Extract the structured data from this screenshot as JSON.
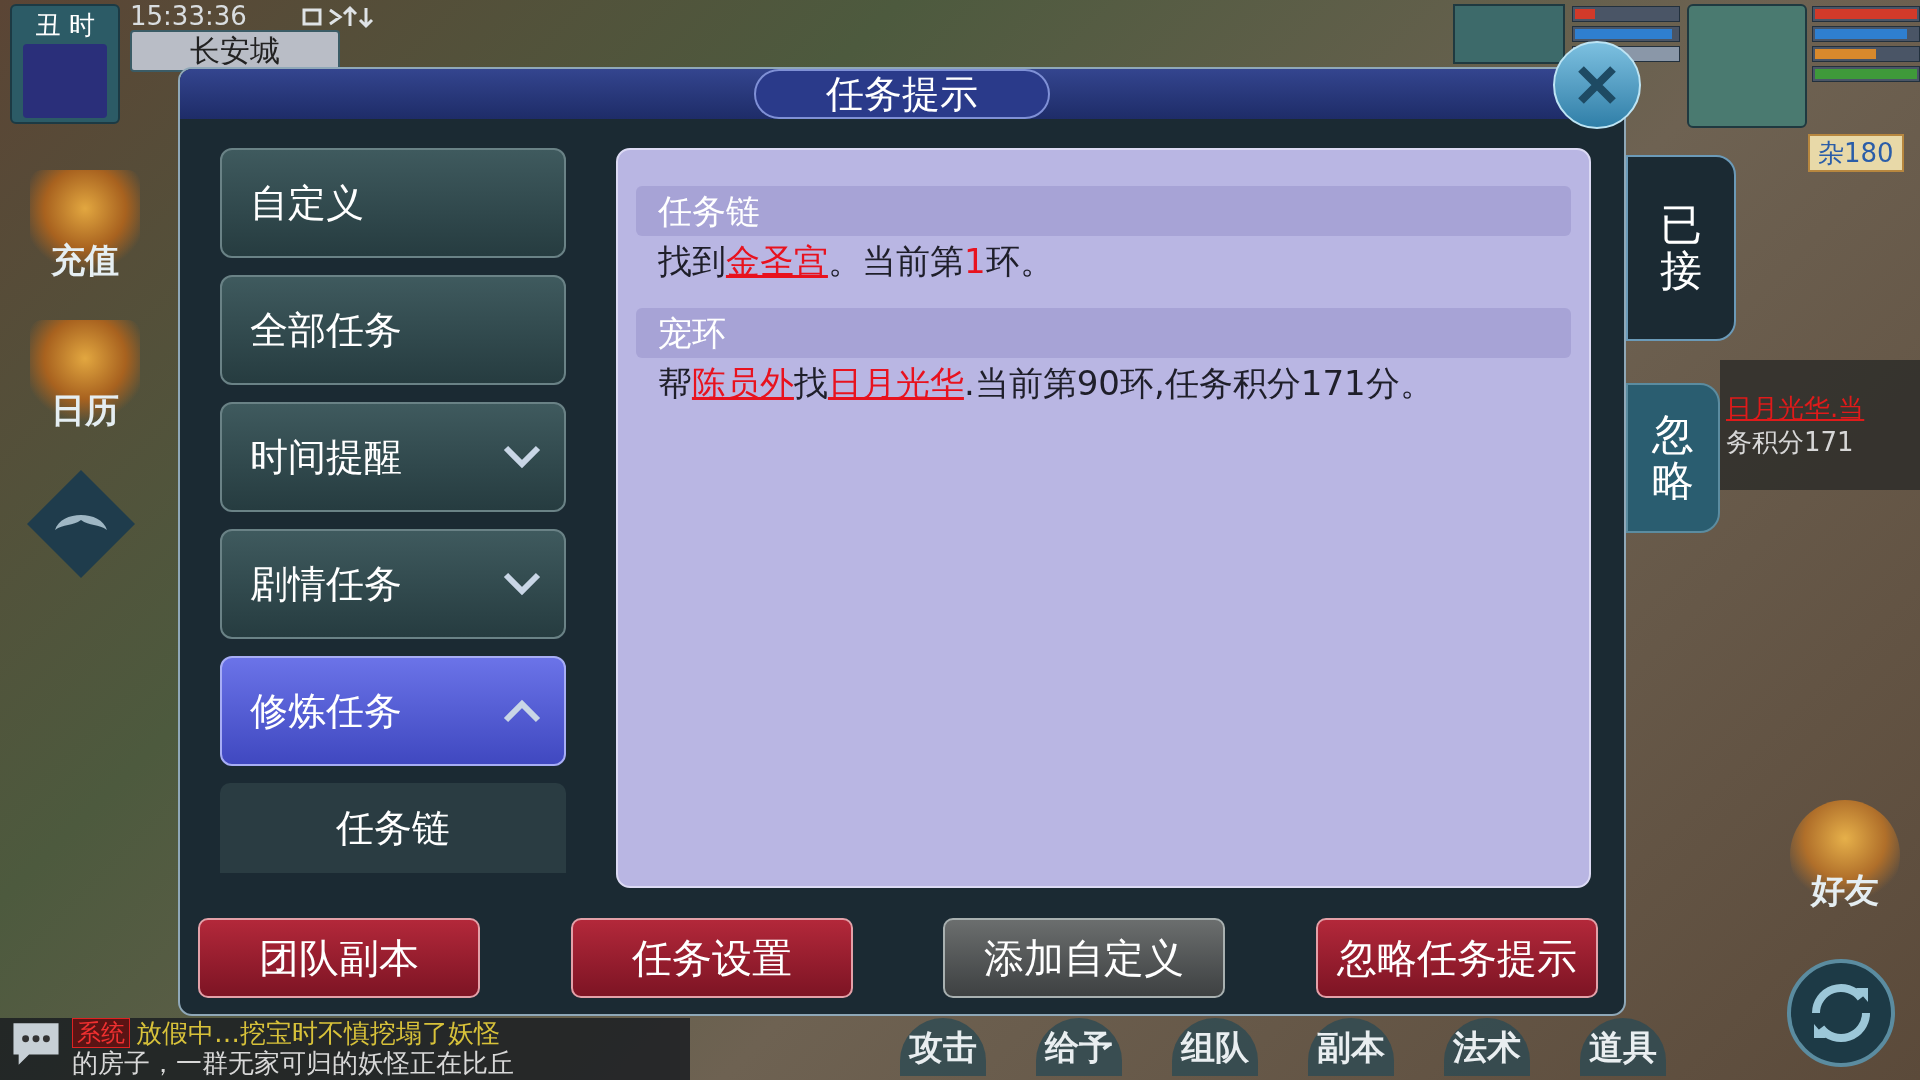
{
  "hud": {
    "time_period": "丑 时",
    "clock": "15:33:36",
    "location": "长安城",
    "side_buttons": [
      "充值",
      "日历"
    ],
    "tag": "杂180",
    "tracker": [
      "日月光华.当",
      "务积分171"
    ],
    "pet_bars": [
      {
        "color": "#d23a2a",
        "level": 0.2
      },
      {
        "color": "#2f7fd0",
        "level": 0.95
      }
    ],
    "player_bars": [
      {
        "color": "#d23a2a",
        "level": 1
      },
      {
        "color": "#2f7fd0",
        "level": 0.9
      },
      {
        "color": "#d8892c",
        "level": 0.6
      },
      {
        "color": "#3f9a3a",
        "level": 1
      }
    ],
    "chat": {
      "channel": "系统",
      "lines": [
        "放假中…挖宝时不慎挖塌了妖怪",
        "的房子，一群无家可归的妖怪正在比丘"
      ]
    },
    "actions": [
      "攻击",
      "给予",
      "组队",
      "副本",
      "法术",
      "道具"
    ],
    "friends": "好友"
  },
  "dialog": {
    "title": "任务提示",
    "menu": [
      {
        "label": "自定义",
        "selected": false
      },
      {
        "label": "全部任务",
        "selected": false
      },
      {
        "label": "时间提醒",
        "selected": false,
        "expanded": false
      },
      {
        "label": "剧情任务",
        "selected": false,
        "expanded": false
      },
      {
        "label": "修炼任务",
        "selected": true,
        "expanded": true,
        "children": [
          {
            "label": "任务链"
          }
        ]
      }
    ],
    "sections": [
      {
        "title": "任务链",
        "segments": [
          {
            "kind": "plain",
            "text": "找到"
          },
          {
            "kind": "link",
            "text": "金圣宫"
          },
          {
            "kind": "plain",
            "text": "。当前第"
          },
          {
            "kind": "highlight",
            "text": "1"
          },
          {
            "kind": "plain",
            "text": "环。"
          }
        ]
      },
      {
        "title": "宠环",
        "segments": [
          {
            "kind": "plain",
            "text": "帮"
          },
          {
            "kind": "link",
            "text": "陈员外"
          },
          {
            "kind": "plain",
            "text": "找"
          },
          {
            "kind": "link",
            "text": "日月光华"
          },
          {
            "kind": "plain",
            "text": ".当前第90环,任务积分171分。"
          }
        ]
      }
    ],
    "side_tabs": [
      {
        "label": "已接",
        "selected": true
      },
      {
        "label": "忽略",
        "selected": false
      }
    ],
    "buttons": [
      {
        "label": "团队副本",
        "kind": "primary"
      },
      {
        "label": "任务设置",
        "kind": "primary"
      },
      {
        "label": "添加自定义",
        "kind": "secondary"
      },
      {
        "label": "忽略任务提示",
        "kind": "primary"
      }
    ]
  }
}
